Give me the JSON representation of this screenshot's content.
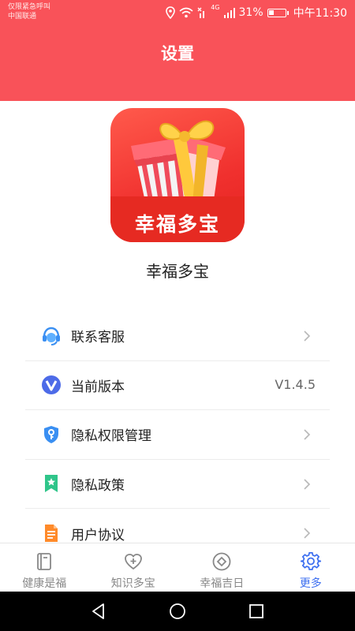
{
  "status": {
    "carrier_line1": "仅限紧急呼叫",
    "carrier_line2": "中国联通",
    "network_label": "4G",
    "battery_percent": "31%",
    "battery_level": 0.31,
    "time": "中午11:30"
  },
  "header": {
    "title": "设置"
  },
  "app": {
    "icon_text": "幸福多宝",
    "name": "幸福多宝"
  },
  "menu": {
    "items": [
      {
        "label": "联系客服",
        "icon": "headset-icon"
      },
      {
        "label": "当前版本",
        "icon": "version-icon",
        "value": "V1.4.5"
      },
      {
        "label": "隐私权限管理",
        "icon": "shield-key-icon"
      },
      {
        "label": "隐私政策",
        "icon": "bookmark-star-icon"
      },
      {
        "label": "用户协议",
        "icon": "document-icon"
      }
    ]
  },
  "tabbar": {
    "tabs": [
      {
        "label": "健康是福",
        "icon": "book-icon"
      },
      {
        "label": "知识多宝",
        "icon": "heart-plus-icon"
      },
      {
        "label": "幸福吉日",
        "icon": "compass-icon"
      },
      {
        "label": "更多",
        "icon": "gear-icon",
        "active": true
      }
    ]
  },
  "colors": {
    "header": "#f95259",
    "accent_blue": "#3d6ff0"
  }
}
